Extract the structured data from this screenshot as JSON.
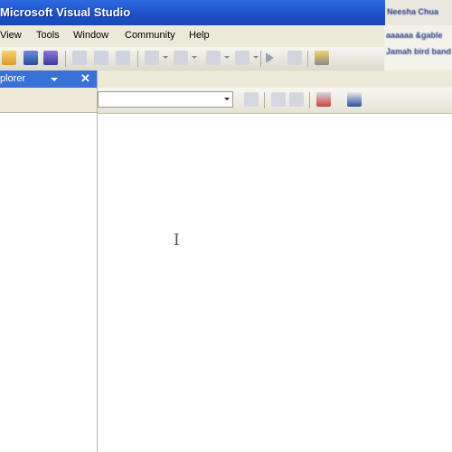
{
  "window": {
    "title": "Microsoft Visual Studio",
    "title_right_line": "Neesha Chua",
    "info_line_1": "aaaaaa &gable",
    "info_line_2": "Jamah bird band"
  },
  "menu": {
    "items": [
      "View",
      "Tools",
      "Window",
      "Community",
      "Help"
    ]
  },
  "toolbar": {
    "icons": [
      "open-folder-icon",
      "save-icon",
      "save-all-icon",
      "cut-icon",
      "copy-icon",
      "paste-icon",
      "undo-icon",
      "redo-icon",
      "navigate-back-icon",
      "navigate-forward-icon",
      "start-debug-icon",
      "step-icon",
      "solution-explorer-icon"
    ]
  },
  "left_panel": {
    "title": "plorer",
    "close_glyph": "✕"
  },
  "main": {
    "combo_value": "",
    "toolbar_icons": [
      "search-icon",
      "web-icon",
      "home-icon",
      "remove-icon",
      "new-window-icon"
    ]
  },
  "colors": {
    "titlebar": "#2055d0",
    "panel_header": "#3a71d8",
    "chrome": "#ece9d8"
  }
}
